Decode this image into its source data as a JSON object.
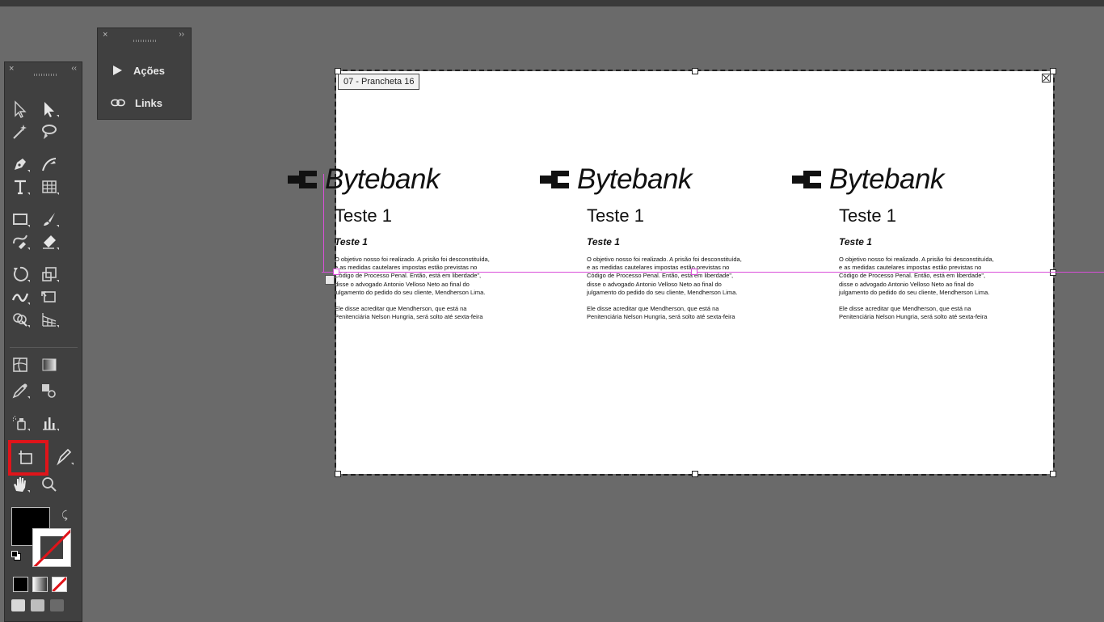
{
  "tools_panel": {
    "close": "×",
    "collapse": "‹‹"
  },
  "actions_panel": {
    "close": "×",
    "collapse": "››",
    "items": [
      {
        "label": "Ações",
        "icon": "play-icon"
      },
      {
        "label": "Links",
        "icon": "link-icon"
      }
    ]
  },
  "artboard": {
    "name": "07 - Prancheta 16"
  },
  "columns": [
    {
      "logo_text": "Bytebank",
      "heading": "Teste 1",
      "subheading": "Teste 1",
      "paragraph1": "O objetivo nosso foi realizado. A prisão foi desconstituída, e as medidas cautelares impostas estão previstas no Código de Processo Penal. Então, está em liberdade\", disse o advogado Antonio Velloso Neto ao final do julgamento do pedido do seu cliente, Mendherson Lima.",
      "paragraph2": "Ele disse acreditar que Mendherson, que está na Penitenciária Nelson Hungria, será solto até sexta-feira"
    },
    {
      "logo_text": "Bytebank",
      "heading": "Teste 1",
      "subheading": "Teste 1",
      "paragraph1": "O objetivo nosso foi realizado. A prisão foi desconstituída, e as medidas cautelares impostas estão previstas no Código de Processo Penal. Então, está em liberdade\", disse o advogado Antonio Velloso Neto ao final do julgamento do pedido do seu cliente, Mendherson Lima.",
      "paragraph2": "Ele disse acreditar que Mendherson, que está na Penitenciária Nelson Hungria, será solto até sexta-feira"
    },
    {
      "logo_text": "Bytebank",
      "heading": "Teste 1",
      "subheading": "Teste 1",
      "paragraph1": "O objetivo nosso foi realizado. A prisão foi desconstituída, e as medidas cautelares impostas estão previstas no Código de Processo Penal. Então, está em liberdade\", disse o advogado Antonio Velloso Neto ao final do julgamento do pedido do seu cliente, Mendherson Lima.",
      "paragraph2": "Ele disse acreditar que Mendherson, que está na Penitenciária Nelson Hungria, será solto até sexta-feira"
    }
  ],
  "colors": {
    "fill": "#000000",
    "highlight": "#e0141a",
    "guide": "#d94fd9"
  }
}
